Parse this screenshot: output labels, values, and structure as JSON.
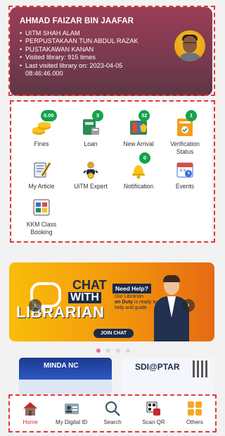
{
  "profile": {
    "name": "AHMAD FAIZAR BIN JAAFAR",
    "details": [
      "UITM SHAH ALAM",
      "PERPUSTAKAAN TUN ABDUL RAZAK",
      "PUSTAKAWAN KANAN",
      "Visited library: 915 times",
      "Last visited library on: 2023-04-05",
      "08:46:46.000"
    ]
  },
  "menu": [
    {
      "label": "Fines",
      "badge": "0.00",
      "icon": "coins-icon"
    },
    {
      "label": "Loan",
      "badge": "3",
      "icon": "book-loan-icon"
    },
    {
      "label": "New Arrival",
      "badge": "32",
      "icon": "new-arrival-icon"
    },
    {
      "label": "Verification Status",
      "badge": "1",
      "icon": "verification-status-icon",
      "label_line1": "Verification",
      "label_line2": "Status"
    },
    {
      "label": "My Article",
      "badge": "",
      "icon": "article-pen-icon"
    },
    {
      "label": "UiTM Expert",
      "badge": "",
      "icon": "expert-medal-icon"
    },
    {
      "label": "Notification",
      "badge": "0",
      "icon": "bell-icon"
    },
    {
      "label": "Events",
      "badge": "",
      "icon": "calendar-icon"
    },
    {
      "label": "KKM Class Booking",
      "badge": "",
      "icon": "class-booking-icon",
      "label_line1": "KKM Class",
      "label_line2": "Booking"
    }
  ],
  "banner": {
    "line_chat": "CHAT",
    "line_with": "WITH",
    "line_librarian": "LIBRARIAN",
    "need_help": "Need Help?",
    "our_text_1": "Our Librarian",
    "our_text_bold": "on Duty",
    "our_text_2": "is ready to help and guide",
    "join": "JOIN CHAT",
    "prev": "‹",
    "next": "›"
  },
  "carousel": {
    "active_index": 0,
    "total": 4
  },
  "thumbs": {
    "minda": "MINDA NC",
    "sdi": "SDI@PTAR"
  },
  "bottom_nav": [
    {
      "label": "Home",
      "icon": "home-icon",
      "active": true
    },
    {
      "label": "My Digital ID",
      "icon": "id-card-icon",
      "active": false
    },
    {
      "label": "Search",
      "icon": "search-icon",
      "active": false
    },
    {
      "label": "Scan QR",
      "icon": "scan-qr-icon",
      "active": false
    },
    {
      "label": "Others",
      "icon": "grid-icon",
      "active": false
    }
  ],
  "colors": {
    "accent_red": "#d32f2f",
    "profile_bg": "#7b3a4f",
    "badge_green": "#15a34a",
    "banner_orange": "#f6a40c"
  }
}
